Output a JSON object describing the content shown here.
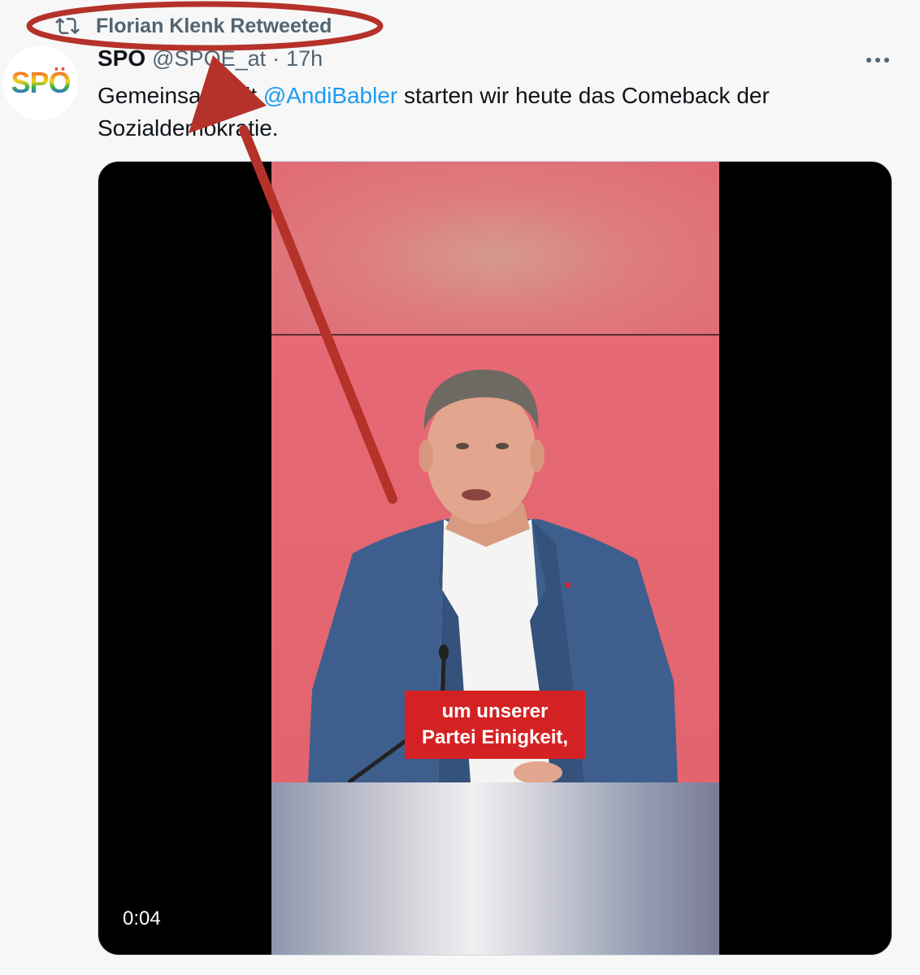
{
  "retweet": {
    "label": "Florian Klenk Retweeted",
    "icon": "retweet-icon"
  },
  "author": {
    "avatar_text": "SPÖ",
    "name": "SPÖ",
    "handle": "@SPOE_at",
    "separator": "·",
    "time": "17h"
  },
  "tweet": {
    "text_before": "Gemeinsam mit ",
    "mention": "@AndiBabler",
    "text_after": " starten wir heute das Comeback der Sozialdemokratie."
  },
  "more_icon": "more-horizontal-icon",
  "video": {
    "subtitle_line1": "um unserer",
    "subtitle_line2": "Partei Einigkeit,",
    "timer": "0:04"
  },
  "colors": {
    "link": "#1d9bf0",
    "annotation": "#b5322a",
    "subtitle_bg": "#d42224",
    "backdrop": "#e2646e"
  }
}
